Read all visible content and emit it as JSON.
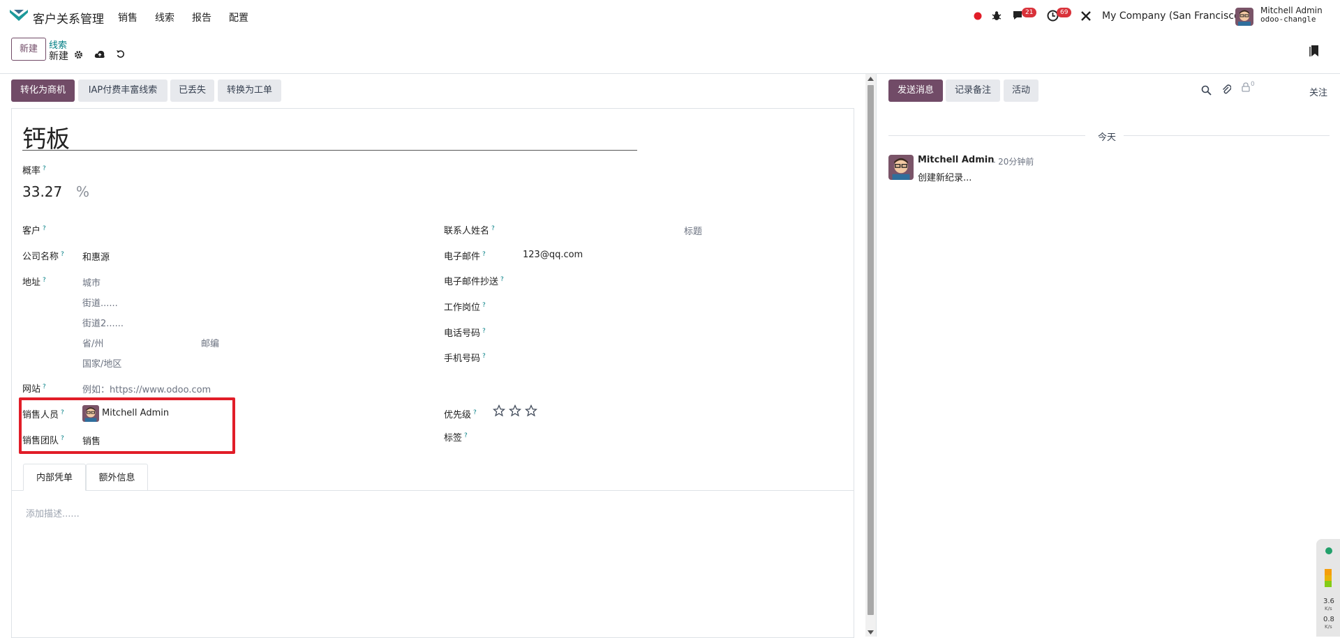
{
  "navbar": {
    "app_name": "客户关系管理",
    "menu": [
      "销售",
      "线索",
      "报告",
      "配置"
    ],
    "messages_count": "21",
    "activities_count": "69",
    "company": "My Company (San Francisco)",
    "user_name": "Mitchell Admin",
    "database": "odoo-changle"
  },
  "control_panel": {
    "new_label": "新建",
    "breadcrumb_parent": "线索",
    "breadcrumb_current": "新建"
  },
  "actions": [
    "转化为商机",
    "IAP付费丰富线索",
    "已丢失",
    "转换为工单"
  ],
  "form": {
    "title": "钙板",
    "probability_label": "概率",
    "probability_value": "33.27",
    "percent": "%",
    "customer_label": "客户",
    "company_label": "公司名称",
    "company_value": "和惠源",
    "address_label": "地址",
    "city_ph": "城市",
    "street_ph": "街道......",
    "street2_ph": "街道2......",
    "state_ph": "省/州",
    "zip_ph": "邮编",
    "country_ph": "国家/地区",
    "website_label": "网站",
    "website_ph": "例如：https://www.odoo.com",
    "salesperson_label": "销售人员",
    "salesperson_value": "Mitchell Admin",
    "team_label": "销售团队",
    "team_value": "销售",
    "contact_label": "联系人姓名",
    "title_ph": "标题",
    "email_label": "电子邮件",
    "email_value": "123@qq.com",
    "email_cc_label": "电子邮件抄送",
    "job_label": "工作岗位",
    "phone_label": "电话号码",
    "mobile_label": "手机号码",
    "priority_label": "优先级",
    "priority_value": 0,
    "tags_label": "标签"
  },
  "tabs": [
    "内部凭单",
    "额外信息"
  ],
  "notes_placeholder": "添加描述......",
  "chatter": {
    "send_label": "发送消息",
    "note_label": "记录备注",
    "activity_label": "活动",
    "follow_label": "关注",
    "followers_count": "0",
    "today_label": "今天",
    "message": {
      "author": "Mitchell Admin",
      "date": "- 20分钟前",
      "body": "创建新纪录..."
    }
  },
  "widget": {
    "up": "3.6",
    "up_unit": "K/s",
    "down": "0.8",
    "down_unit": "K/s"
  },
  "colors": {
    "brand": "#714b67",
    "accent": "#017e84",
    "highlight": "#e11d28"
  }
}
